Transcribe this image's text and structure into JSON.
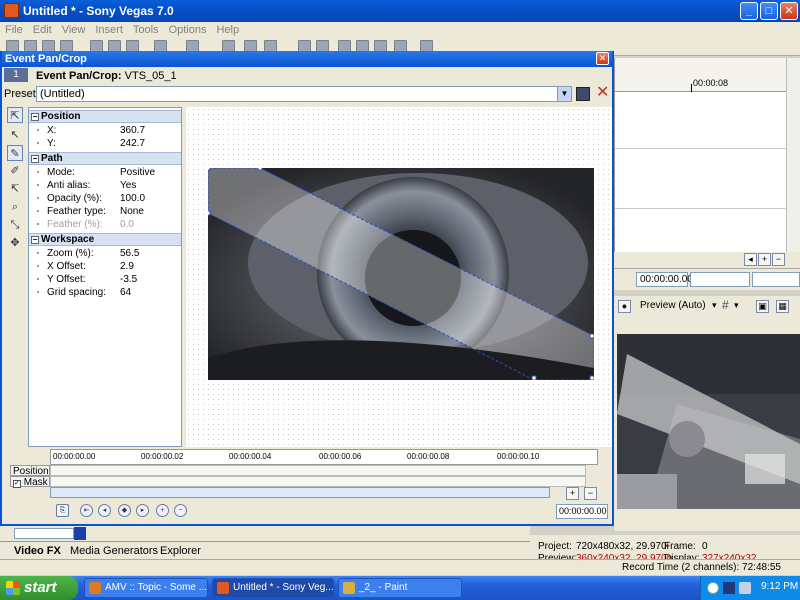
{
  "window": {
    "title": "Untitled * - Sony Vegas 7.0"
  },
  "menu": [
    "File",
    "Edit",
    "View",
    "Insert",
    "Tools",
    "Options",
    "Help"
  ],
  "dialog": {
    "title": "Event Pan/Crop",
    "track_number": "1",
    "event_label": "Event Pan/Crop:",
    "event_name": "VTS_05_1",
    "preset_label": "Preset:",
    "preset_value": "(Untitled)",
    "sections": {
      "position": {
        "title": "Position",
        "rows": [
          {
            "label": "X:",
            "value": "360.7"
          },
          {
            "label": "Y:",
            "value": "242.7"
          }
        ]
      },
      "path": {
        "title": "Path",
        "rows": [
          {
            "label": "Mode:",
            "value": "Positive"
          },
          {
            "label": "Anti alias:",
            "value": "Yes"
          },
          {
            "label": "Opacity (%):",
            "value": "100.0"
          },
          {
            "label": "Feather type:",
            "value": "None"
          },
          {
            "label": "Feather (%):",
            "value": "0.0"
          }
        ]
      },
      "workspace": {
        "title": "Workspace",
        "rows": [
          {
            "label": "Zoom (%):",
            "value": "56.5"
          },
          {
            "label": "X Offset:",
            "value": "2.9"
          },
          {
            "label": "Y Offset:",
            "value": "-3.5"
          },
          {
            "label": "Grid spacing:",
            "value": "64"
          }
        ]
      }
    },
    "timeline": {
      "ticks": [
        "00:00:00.00",
        "00:00:00.02",
        "00:00:00.04",
        "00:00:00.06",
        "00:00:00.08",
        "00:00:00.10"
      ],
      "tracks": [
        "Position",
        "Mask"
      ],
      "current_time": "00:00:00.00"
    }
  },
  "right_panel": {
    "ruler_time": "00:00:08",
    "time_display": "00:00:00.00",
    "preview_mode": "Preview (Auto)"
  },
  "preview_info": {
    "project_label": "Project:",
    "project_value": "720x480x32, 29.970i",
    "frame_label": "Frame:",
    "frame_value": "0",
    "preview_label": "Preview:",
    "preview_value": "360x240x32, 29.970p",
    "display_label": "Display:",
    "display_value": "327x240x32"
  },
  "bottom_tabs": [
    "Video FX",
    "Media Generators",
    "Explorer"
  ],
  "status": {
    "record_time": "Record Time (2 channels): 72:48:55"
  },
  "taskbar": {
    "start": "start",
    "tasks": [
      "AMV :: Topic - Some ...",
      "Untitled * - Sony Veg...",
      "_2_ - Paint"
    ],
    "clock": "9:12 PM"
  }
}
